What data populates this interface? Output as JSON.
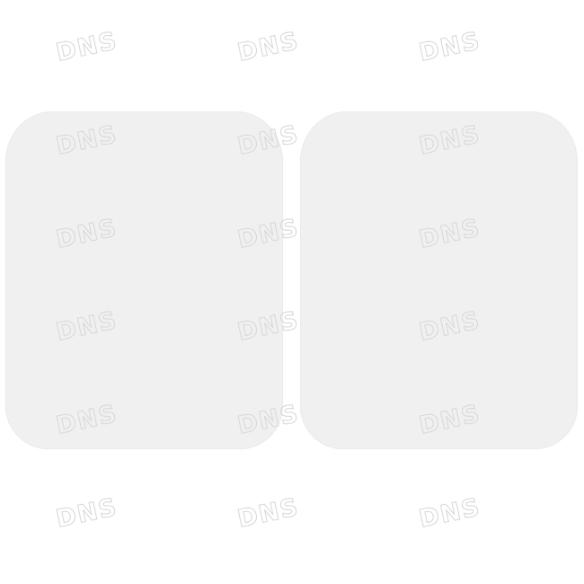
{
  "image": {
    "background_color": "#ffffff",
    "plate_color": "#f0f0f0"
  },
  "watermark": {
    "text": "DNS",
    "color": "#d8d8d8"
  }
}
